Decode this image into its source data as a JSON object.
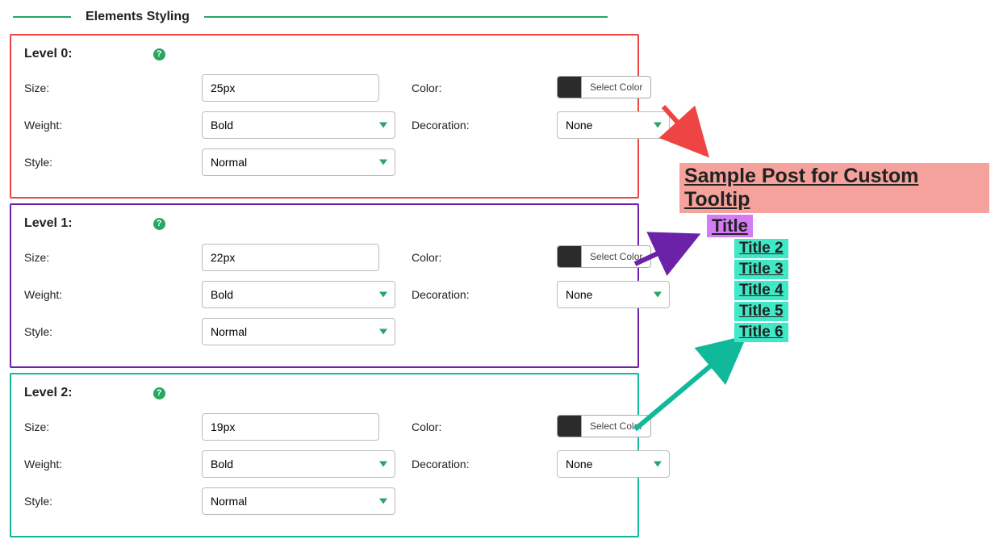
{
  "header": {
    "title": "Elements Styling"
  },
  "labels": {
    "size": "Size:",
    "weight": "Weight:",
    "style": "Style:",
    "color": "Color:",
    "decoration": "Decoration:",
    "select_color": "Select Color"
  },
  "levels": [
    {
      "title": "Level 0:",
      "size": "25px",
      "weight": "Bold",
      "style": "Normal",
      "decoration": "None",
      "border_color": "#ef4444"
    },
    {
      "title": "Level 1:",
      "size": "22px",
      "weight": "Bold",
      "style": "Normal",
      "decoration": "None",
      "border_color": "#6b21a8"
    },
    {
      "title": "Level 2:",
      "size": "19px",
      "weight": "Bold",
      "style": "Normal",
      "decoration": "None",
      "border_color": "#10b99a"
    }
  ],
  "preview": {
    "h0": "Sample Post for Custom Tooltip",
    "h1": "Title",
    "h2": [
      "Title 2",
      "Title 3",
      "Title 4",
      "Title 5",
      "Title 6"
    ]
  },
  "options": {
    "weight": [
      "Bold"
    ],
    "style": [
      "Normal"
    ],
    "decoration": [
      "None"
    ]
  }
}
